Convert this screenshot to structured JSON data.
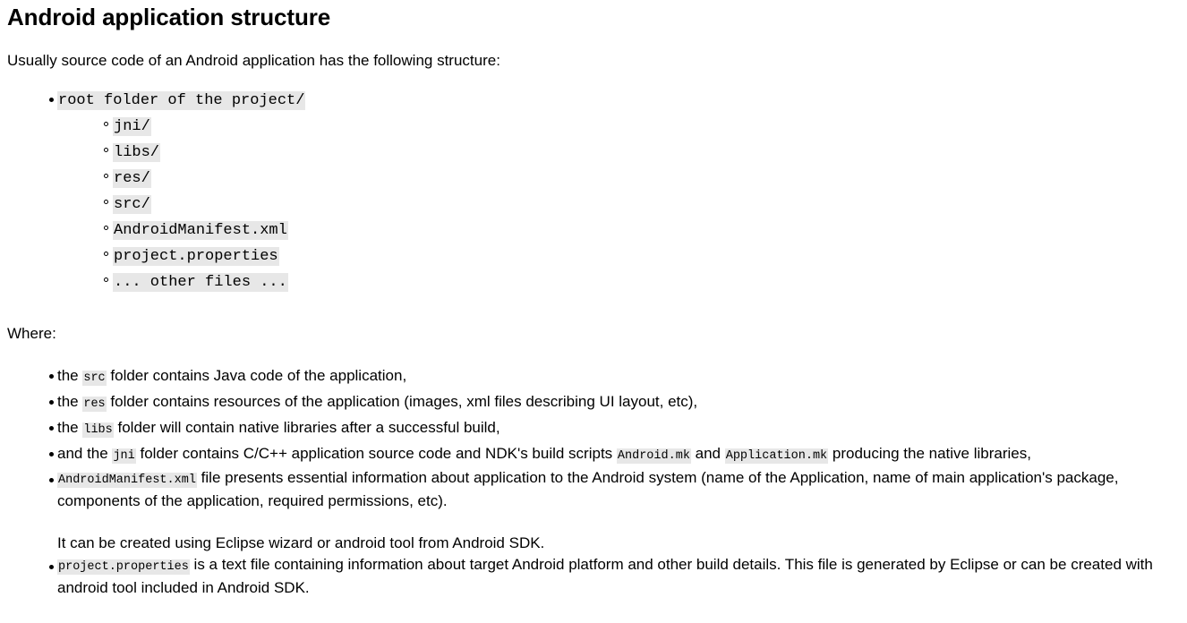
{
  "document": {
    "title": "Android application structure",
    "intro_paragraph": "Usually source code of an Android application has the following structure:",
    "where_label": "Where:",
    "code_background_color": "#e7e7e7",
    "text_color": "#000000",
    "page_background_color": "#ffffff"
  },
  "structure_tree": {
    "root": "root folder of the project/",
    "children": [
      "jni/",
      "libs/",
      "res/",
      "src/",
      "AndroidManifest.xml",
      "project.properties",
      "... other files ..."
    ]
  },
  "where_items": [
    {
      "id": "src",
      "parts": [
        {
          "type": "text",
          "value": "the "
        },
        {
          "type": "code",
          "value": "src"
        },
        {
          "type": "text",
          "value": " folder contains Java code of the application,"
        }
      ]
    },
    {
      "id": "res",
      "parts": [
        {
          "type": "text",
          "value": "the "
        },
        {
          "type": "code",
          "value": "res"
        },
        {
          "type": "text",
          "value": " folder contains resources of the application (images, xml files describing UI layout, etc),"
        }
      ]
    },
    {
      "id": "libs",
      "parts": [
        {
          "type": "text",
          "value": "the "
        },
        {
          "type": "code",
          "value": "libs"
        },
        {
          "type": "text",
          "value": " folder will contain native libraries after a successful build,"
        }
      ]
    },
    {
      "id": "jni",
      "parts": [
        {
          "type": "text",
          "value": "and the "
        },
        {
          "type": "code",
          "value": "jni"
        },
        {
          "type": "text",
          "value": " folder contains C/C++ application source code and NDK's build scripts "
        },
        {
          "type": "code",
          "value": "Android.mk"
        },
        {
          "type": "text",
          "value": " and "
        },
        {
          "type": "code",
          "value": "Application.mk"
        },
        {
          "type": "text",
          "value": " producing the native libraries,"
        }
      ]
    },
    {
      "id": "manifest",
      "parts": [
        {
          "type": "code",
          "value": "AndroidManifest.xml"
        },
        {
          "type": "text",
          "value": " file presents essential information about application to the Android system (name of the Application, name of main application's package, components of the application, required permissions, etc)."
        }
      ],
      "sub_paragraph": "It can be created using Eclipse wizard or android tool from Android SDK."
    },
    {
      "id": "properties",
      "parts": [
        {
          "type": "code",
          "value": "project.properties"
        },
        {
          "type": "text",
          "value": " is a text file containing information about target Android platform and other build details. This file is generated by Eclipse or can be created with android tool included in Android SDK."
        }
      ]
    }
  ]
}
